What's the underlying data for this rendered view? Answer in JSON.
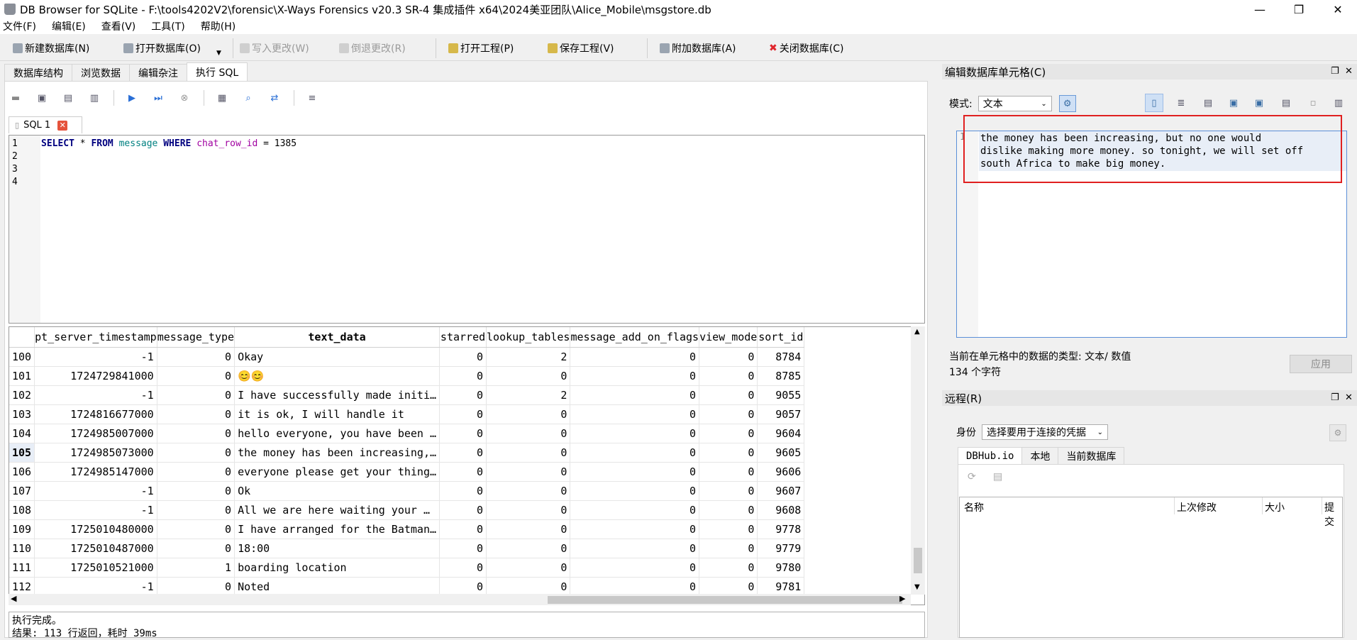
{
  "window": {
    "title": "DB Browser for SQLite - F:\\tools4202V2\\forensic\\X-Ways Forensics v20.3 SR-4 集成插件 x64\\2024美亚团队\\Alice_Mobile\\msgstore.db",
    "minimize": "—",
    "maximize": "❐",
    "close": "✕"
  },
  "menu": [
    "文件(F)",
    "编辑(E)",
    "查看(V)",
    "工具(T)",
    "帮助(H)"
  ],
  "toolbar": {
    "new_db": "新建数据库(N)",
    "open_db": "打开数据库(O)",
    "write": "写入更改(W)",
    "revert": "倒退更改(R)",
    "open_proj": "打开工程(P)",
    "save_proj": "保存工程(V)",
    "attach_db": "附加数据库(A)",
    "close_db": "关闭数据库(C)"
  },
  "tabs": [
    "数据库结构",
    "浏览数据",
    "编辑杂注",
    "执行 SQL"
  ],
  "sql_tab": {
    "label": "SQL 1"
  },
  "sql": {
    "line_numbers": [
      "1",
      "2",
      "3",
      "4"
    ],
    "select": "SELECT",
    "star": " * ",
    "from": "FROM",
    "table": "message",
    "where": "WHERE",
    "column": "chat_row_id",
    "eq": " = 1385"
  },
  "grid": {
    "columns": [
      "pt_server_timestamp",
      "message_type",
      "text_data",
      "starred",
      "lookup_tables",
      "message_add_on_flags",
      "view_mode",
      "sort_id"
    ],
    "rows": [
      {
        "n": "100",
        "ts": "-1",
        "mt": "0",
        "text": "Okay",
        "st": "0",
        "lt": "2",
        "fl": "0",
        "vm": "0",
        "sid": "8784"
      },
      {
        "n": "101",
        "ts": "1724729841000",
        "mt": "0",
        "text": "😊😊",
        "st": "0",
        "lt": "0",
        "fl": "0",
        "vm": "0",
        "sid": "8785"
      },
      {
        "n": "102",
        "ts": "-1",
        "mt": "0",
        "text": "I have successfully made initi…",
        "st": "0",
        "lt": "2",
        "fl": "0",
        "vm": "0",
        "sid": "9055"
      },
      {
        "n": "103",
        "ts": "1724816677000",
        "mt": "0",
        "text": "it is ok, I will handle it",
        "st": "0",
        "lt": "0",
        "fl": "0",
        "vm": "0",
        "sid": "9057"
      },
      {
        "n": "104",
        "ts": "1724985007000",
        "mt": "0",
        "text": "hello everyone, you have been …",
        "st": "0",
        "lt": "0",
        "fl": "0",
        "vm": "0",
        "sid": "9604"
      },
      {
        "n": "105",
        "ts": "1724985073000",
        "mt": "0",
        "text": "the money has been increasing,…",
        "st": "0",
        "lt": "0",
        "fl": "0",
        "vm": "0",
        "sid": "9605"
      },
      {
        "n": "106",
        "ts": "1724985147000",
        "mt": "0",
        "text": "everyone please get your thing…",
        "st": "0",
        "lt": "0",
        "fl": "0",
        "vm": "0",
        "sid": "9606"
      },
      {
        "n": "107",
        "ts": "-1",
        "mt": "0",
        "text": "Ok",
        "st": "0",
        "lt": "0",
        "fl": "0",
        "vm": "0",
        "sid": "9607"
      },
      {
        "n": "108",
        "ts": "-1",
        "mt": "0",
        "text": "All we are here waiting your …",
        "st": "0",
        "lt": "0",
        "fl": "0",
        "vm": "0",
        "sid": "9608"
      },
      {
        "n": "109",
        "ts": "1725010480000",
        "mt": "0",
        "text": "I have arranged for the Batman…",
        "st": "0",
        "lt": "0",
        "fl": "0",
        "vm": "0",
        "sid": "9778"
      },
      {
        "n": "110",
        "ts": "1725010487000",
        "mt": "0",
        "text": "18:00",
        "st": "0",
        "lt": "0",
        "fl": "0",
        "vm": "0",
        "sid": "9779"
      },
      {
        "n": "111",
        "ts": "1725010521000",
        "mt": "1",
        "text": "boarding location",
        "st": "0",
        "lt": "0",
        "fl": "0",
        "vm": "0",
        "sid": "9780"
      },
      {
        "n": "112",
        "ts": "-1",
        "mt": "0",
        "text": "Noted",
        "st": "0",
        "lt": "0",
        "fl": "0",
        "vm": "0",
        "sid": "9781"
      }
    ],
    "selected_row": "105"
  },
  "status": {
    "line1": "执行完成。",
    "line2": "结果: 113 行返回，耗时 39ms"
  },
  "cell_editor": {
    "title": "编辑数据库单元格(C)",
    "mode_label": "模式:",
    "mode_value": "文本",
    "line_no": "1",
    "text": "the money has been increasing, but no one would\ndislike making more money. so tonight, we will set off\nsouth Africa to make big money.",
    "type_info": "当前在单元格中的数据的类型: 文本/ 数值",
    "char_count": "134 个字符",
    "apply": "应用"
  },
  "remote": {
    "title": "远程(R)",
    "identity_label": "身份",
    "identity_value": "选择要用于连接的凭据",
    "tabs": [
      "DBHub.io",
      "本地",
      "当前数据库"
    ],
    "columns": [
      "名称",
      "上次修改",
      "大小",
      "提交"
    ]
  },
  "colors": {
    "red_highlight": "#e02020",
    "selection": "#e8eef7",
    "keyword": "#00007f"
  }
}
